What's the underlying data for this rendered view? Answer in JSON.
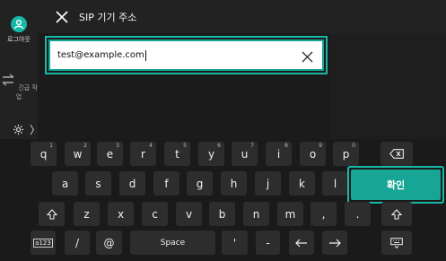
{
  "header": {
    "title": "SIP 기기 주소"
  },
  "sidebar": {
    "logout_label": "로그아웃",
    "quick_label": "긴급 작업",
    "gear_label": "〉"
  },
  "input": {
    "value": "test@example.com"
  },
  "keyboard": {
    "row1": [
      {
        "label": "q",
        "sup": "1"
      },
      {
        "label": "w",
        "sup": "2"
      },
      {
        "label": "e",
        "sup": "3"
      },
      {
        "label": "r",
        "sup": "4"
      },
      {
        "label": "t",
        "sup": "5"
      },
      {
        "label": "y",
        "sup": "6"
      },
      {
        "label": "u",
        "sup": "7"
      },
      {
        "label": "i",
        "sup": "8"
      },
      {
        "label": "o",
        "sup": "9"
      },
      {
        "label": "p",
        "sup": "0"
      }
    ],
    "row2": [
      "a",
      "s",
      "d",
      "f",
      "g",
      "h",
      "j",
      "k",
      "l"
    ],
    "row3": [
      "z",
      "x",
      "c",
      "v",
      "b",
      "n",
      "m",
      ",",
      "."
    ],
    "row4": {
      "mode": "a123",
      "slash": "/",
      "at": "@",
      "space": "Space",
      "quote": "'",
      "dash": "-"
    },
    "confirm_label": "확인"
  }
}
